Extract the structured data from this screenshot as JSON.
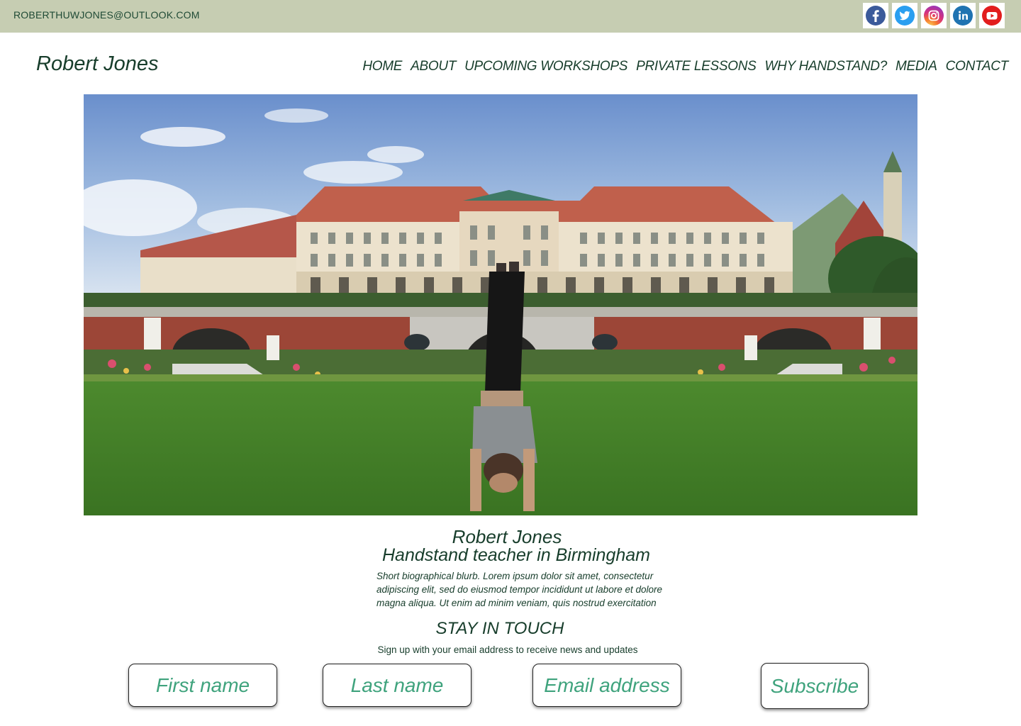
{
  "topbar": {
    "email": "ROBERTHUWJONES@OUTLOOK.COM",
    "socials": [
      {
        "name": "facebook",
        "icon": "facebook-icon",
        "glyph": "f",
        "color": "#3b5a9a"
      },
      {
        "name": "twitter",
        "icon": "twitter-icon",
        "glyph": "🐦",
        "color": "#2a9ff0"
      },
      {
        "name": "instagram",
        "icon": "instagram-icon",
        "glyph": "",
        "color": "#d9327a"
      },
      {
        "name": "linkedin",
        "icon": "linkedin-icon",
        "glyph": "in",
        "color": "#1f73b1"
      },
      {
        "name": "youtube",
        "icon": "youtube-icon",
        "glyph": "",
        "color": "#e21d1d"
      }
    ]
  },
  "header": {
    "brand": "Robert Jones",
    "nav": [
      "HOME",
      "ABOUT",
      "UPCOMING WORKSHOPS",
      "PRIVATE LESSONS",
      "WHY HANDSTAND?",
      "MEDIA",
      "CONTACT"
    ]
  },
  "hero": {
    "image": "handstand-in-front-of-palace-photo"
  },
  "intro": {
    "name": "Robert Jones",
    "subtitle": "Handstand teacher in Birmingham",
    "bio": "Short biographical blurb. Lorem ipsum dolor sit amet, consectetur adipiscing elit, sed do eiusmod tempor incididunt ut labore et dolore magna aliqua. Ut enim ad minim veniam, quis nostrud exercitation"
  },
  "newsletter": {
    "heading": "STAY IN TOUCH",
    "description": "Sign up with your email address to receive news and updates",
    "first_name_placeholder": "First name",
    "last_name_placeholder": "Last name",
    "email_placeholder": "Email address",
    "subscribe_label": "Subscribe"
  },
  "colors": {
    "topbar_bg": "#c6cdb2",
    "text": "#173d2b",
    "accent": "#3fa37d"
  }
}
